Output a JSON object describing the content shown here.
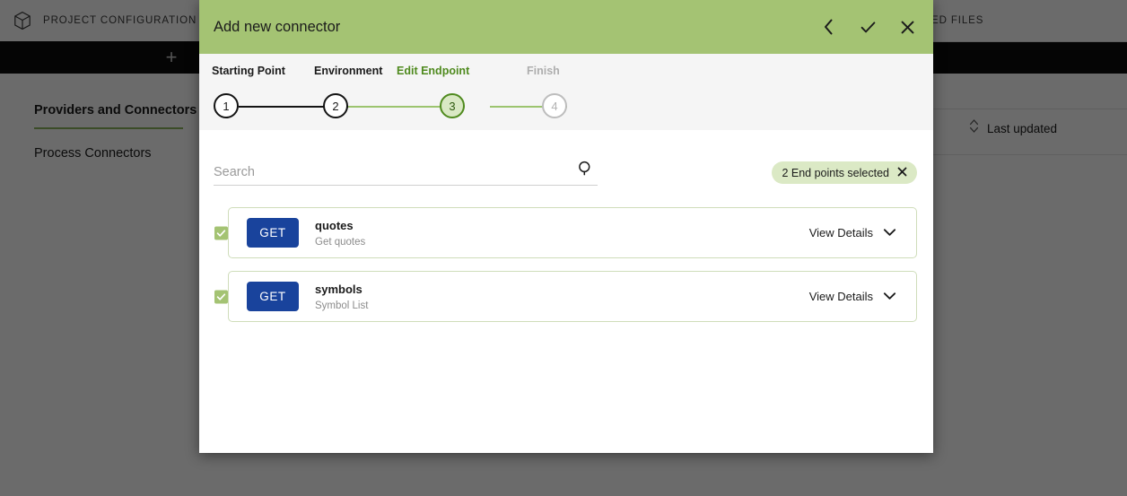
{
  "background": {
    "app_title": "PROJECT CONFIGURATION",
    "cube_icon": "cube-icon",
    "add_icon": "plus-icon",
    "tab_label": "ED FILES",
    "sort_label": "Last updated",
    "sort_icon": "sort-updown-icon",
    "nav": [
      {
        "label": "Providers and Connectors",
        "active": true
      },
      {
        "label": "Process Connectors",
        "active": false
      }
    ]
  },
  "modal": {
    "title": "Add new connector",
    "header_actions": [
      {
        "name": "back-icon",
        "glyph": "chevron-left"
      },
      {
        "name": "confirm-icon",
        "glyph": "check"
      },
      {
        "name": "close-icon",
        "glyph": "x"
      }
    ],
    "stepper": {
      "steps": [
        {
          "number": "1",
          "label": "Starting Point",
          "state": "done"
        },
        {
          "number": "2",
          "label": "Environment",
          "state": "done"
        },
        {
          "number": "3",
          "label": "Edit Endpoint",
          "state": "current"
        },
        {
          "number": "4",
          "label": "Finish",
          "state": "todo"
        }
      ]
    },
    "search": {
      "placeholder": "Search",
      "value": "",
      "icon": "search-icon"
    },
    "selected_chip": {
      "label": "2 End points selected",
      "clear_icon": "close-icon"
    },
    "endpoints": [
      {
        "checked": true,
        "method": "GET",
        "name": "quotes",
        "description": "Get quotes",
        "details_label": "View Details",
        "details_icon": "chevron-down-icon"
      },
      {
        "checked": true,
        "method": "GET",
        "name": "symbols",
        "description": "Symbol List",
        "details_label": "View Details",
        "details_icon": "chevron-down-icon"
      }
    ]
  },
  "colors": {
    "header_green": "#a4c373",
    "accent_green": "#4f8a1e",
    "chip_green": "#dbe9c5",
    "method_blue": "#19439c"
  }
}
